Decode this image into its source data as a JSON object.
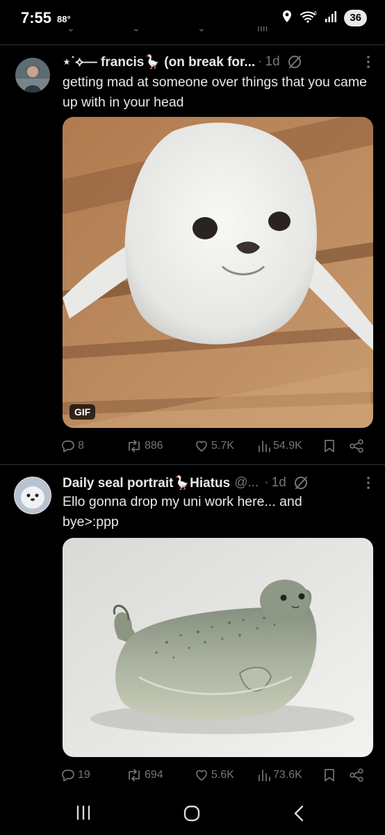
{
  "status_bar": {
    "time": "7:55",
    "temperature": "88°",
    "battery": "36",
    "icons": [
      "location-icon",
      "wifi-6-icon",
      "signal-icon"
    ]
  },
  "tweets": [
    {
      "display_name": "⋆˙⟡— francis🪿 (on break for...",
      "handle": "",
      "separator": "·",
      "time": "1d",
      "text": "getting mad at someone over things that you came up with in your head",
      "media": {
        "kind": "gif",
        "badge": "GIF",
        "subject": "baby seal"
      },
      "stats": {
        "replies": "8",
        "reposts": "886",
        "likes": "5.7K",
        "views": "54.9K"
      }
    },
    {
      "display_name": "Daily seal portrait🪿Hiatus",
      "handle": "@...",
      "separator": "·",
      "time": "1d",
      "text": "Ello gonna drop my uni work here... and bye>:ppp",
      "media": {
        "kind": "image",
        "badge": "",
        "subject": "ceramic seal sculpture"
      },
      "stats": {
        "replies": "19",
        "reposts": "694",
        "likes": "5.6K",
        "views": "73.6K"
      }
    }
  ],
  "colors": {
    "background": "#000000",
    "text": "#e7e9ea",
    "muted": "#71767b",
    "divider": "#2f3336"
  },
  "nav_bar": {
    "icons": [
      "recent-apps-icon",
      "home-icon",
      "back-icon"
    ]
  }
}
